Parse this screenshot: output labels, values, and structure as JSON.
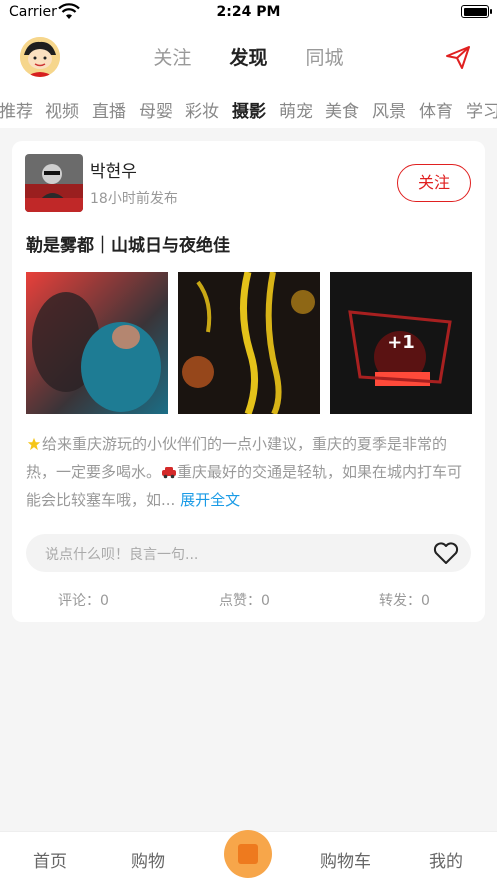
{
  "status": {
    "carrier": "Carrier",
    "time": "2:24 PM"
  },
  "header": {
    "tabs": [
      {
        "label": "关注",
        "active": false
      },
      {
        "label": "发现",
        "active": true
      },
      {
        "label": "同城",
        "active": false
      }
    ],
    "send_icon": "send-icon"
  },
  "categories": {
    "items": [
      "推荐",
      "视频",
      "直播",
      "母婴",
      "彩妆",
      "摄影",
      "萌宠",
      "美食",
      "风景",
      "体育",
      "学习"
    ],
    "active": "摄影"
  },
  "post": {
    "user_name": "박현우",
    "time": "18小时前发布",
    "follow_label": "关注",
    "title": "勒是雾都｜山城日与夜绝佳",
    "more_images": "+1",
    "body_text_1": "给来重庆游玩的小伙伴们的一点小建议，重庆的夏季是非常的热，一定要多喝水。",
    "body_text_2": "重庆最好的交通是轻轨，如果在城内打车可能会比较塞车哦，如...",
    "expand_label": " 展开全文",
    "comment_placeholder": "说点什么呗！良言一句...",
    "comments": "评论：0",
    "likes": "点赞：0",
    "shares": "转发：0"
  },
  "tabbar": {
    "home": "首页",
    "shop": "购物",
    "cart": "购物车",
    "mine": "我的"
  },
  "colors": {
    "accent": "#e02020",
    "link": "#1a9be6",
    "tab_center": "#f7a64a"
  }
}
